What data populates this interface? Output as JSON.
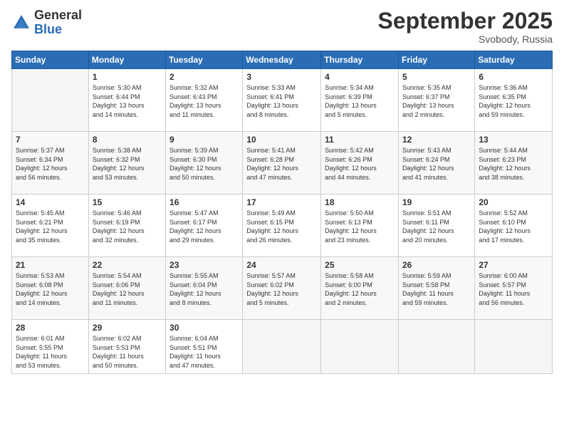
{
  "header": {
    "logo_general": "General",
    "logo_blue": "Blue",
    "month_title": "September 2025",
    "location": "Svobody, Russia"
  },
  "days_of_week": [
    "Sunday",
    "Monday",
    "Tuesday",
    "Wednesday",
    "Thursday",
    "Friday",
    "Saturday"
  ],
  "weeks": [
    [
      {
        "day": "",
        "info": ""
      },
      {
        "day": "1",
        "info": "Sunrise: 5:30 AM\nSunset: 6:44 PM\nDaylight: 13 hours\nand 14 minutes."
      },
      {
        "day": "2",
        "info": "Sunrise: 5:32 AM\nSunset: 6:43 PM\nDaylight: 13 hours\nand 11 minutes."
      },
      {
        "day": "3",
        "info": "Sunrise: 5:33 AM\nSunset: 6:41 PM\nDaylight: 13 hours\nand 8 minutes."
      },
      {
        "day": "4",
        "info": "Sunrise: 5:34 AM\nSunset: 6:39 PM\nDaylight: 13 hours\nand 5 minutes."
      },
      {
        "day": "5",
        "info": "Sunrise: 5:35 AM\nSunset: 6:37 PM\nDaylight: 13 hours\nand 2 minutes."
      },
      {
        "day": "6",
        "info": "Sunrise: 5:36 AM\nSunset: 6:35 PM\nDaylight: 12 hours\nand 59 minutes."
      }
    ],
    [
      {
        "day": "7",
        "info": "Sunrise: 5:37 AM\nSunset: 6:34 PM\nDaylight: 12 hours\nand 56 minutes."
      },
      {
        "day": "8",
        "info": "Sunrise: 5:38 AM\nSunset: 6:32 PM\nDaylight: 12 hours\nand 53 minutes."
      },
      {
        "day": "9",
        "info": "Sunrise: 5:39 AM\nSunset: 6:30 PM\nDaylight: 12 hours\nand 50 minutes."
      },
      {
        "day": "10",
        "info": "Sunrise: 5:41 AM\nSunset: 6:28 PM\nDaylight: 12 hours\nand 47 minutes."
      },
      {
        "day": "11",
        "info": "Sunrise: 5:42 AM\nSunset: 6:26 PM\nDaylight: 12 hours\nand 44 minutes."
      },
      {
        "day": "12",
        "info": "Sunrise: 5:43 AM\nSunset: 6:24 PM\nDaylight: 12 hours\nand 41 minutes."
      },
      {
        "day": "13",
        "info": "Sunrise: 5:44 AM\nSunset: 6:23 PM\nDaylight: 12 hours\nand 38 minutes."
      }
    ],
    [
      {
        "day": "14",
        "info": "Sunrise: 5:45 AM\nSunset: 6:21 PM\nDaylight: 12 hours\nand 35 minutes."
      },
      {
        "day": "15",
        "info": "Sunrise: 5:46 AM\nSunset: 6:19 PM\nDaylight: 12 hours\nand 32 minutes."
      },
      {
        "day": "16",
        "info": "Sunrise: 5:47 AM\nSunset: 6:17 PM\nDaylight: 12 hours\nand 29 minutes."
      },
      {
        "day": "17",
        "info": "Sunrise: 5:49 AM\nSunset: 6:15 PM\nDaylight: 12 hours\nand 26 minutes."
      },
      {
        "day": "18",
        "info": "Sunrise: 5:50 AM\nSunset: 6:13 PM\nDaylight: 12 hours\nand 23 minutes."
      },
      {
        "day": "19",
        "info": "Sunrise: 5:51 AM\nSunset: 6:11 PM\nDaylight: 12 hours\nand 20 minutes."
      },
      {
        "day": "20",
        "info": "Sunrise: 5:52 AM\nSunset: 6:10 PM\nDaylight: 12 hours\nand 17 minutes."
      }
    ],
    [
      {
        "day": "21",
        "info": "Sunrise: 5:53 AM\nSunset: 6:08 PM\nDaylight: 12 hours\nand 14 minutes."
      },
      {
        "day": "22",
        "info": "Sunrise: 5:54 AM\nSunset: 6:06 PM\nDaylight: 12 hours\nand 11 minutes."
      },
      {
        "day": "23",
        "info": "Sunrise: 5:55 AM\nSunset: 6:04 PM\nDaylight: 12 hours\nand 8 minutes."
      },
      {
        "day": "24",
        "info": "Sunrise: 5:57 AM\nSunset: 6:02 PM\nDaylight: 12 hours\nand 5 minutes."
      },
      {
        "day": "25",
        "info": "Sunrise: 5:58 AM\nSunset: 6:00 PM\nDaylight: 12 hours\nand 2 minutes."
      },
      {
        "day": "26",
        "info": "Sunrise: 5:59 AM\nSunset: 5:58 PM\nDaylight: 11 hours\nand 59 minutes."
      },
      {
        "day": "27",
        "info": "Sunrise: 6:00 AM\nSunset: 5:57 PM\nDaylight: 11 hours\nand 56 minutes."
      }
    ],
    [
      {
        "day": "28",
        "info": "Sunrise: 6:01 AM\nSunset: 5:55 PM\nDaylight: 11 hours\nand 53 minutes."
      },
      {
        "day": "29",
        "info": "Sunrise: 6:02 AM\nSunset: 5:53 PM\nDaylight: 11 hours\nand 50 minutes."
      },
      {
        "day": "30",
        "info": "Sunrise: 6:04 AM\nSunset: 5:51 PM\nDaylight: 11 hours\nand 47 minutes."
      },
      {
        "day": "",
        "info": ""
      },
      {
        "day": "",
        "info": ""
      },
      {
        "day": "",
        "info": ""
      },
      {
        "day": "",
        "info": ""
      }
    ]
  ]
}
